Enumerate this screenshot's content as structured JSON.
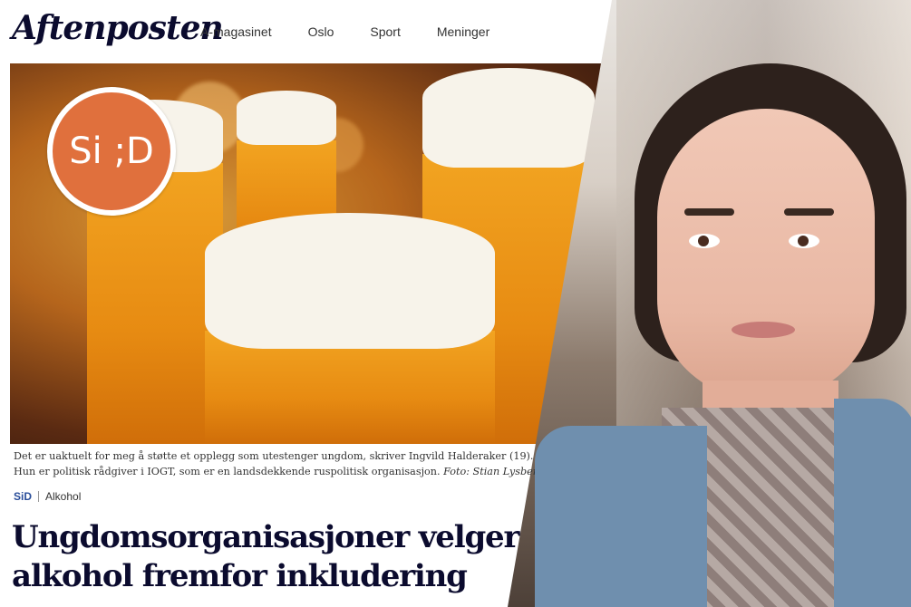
{
  "header": {
    "logo": "Aftenposten",
    "nav": [
      "A-magasinet",
      "Oslo",
      "Sport",
      "Meninger"
    ]
  },
  "hero": {
    "badge_text": "Si ;D",
    "badge_color": "#e0703d"
  },
  "caption": {
    "line1": "Det er uaktuelt for meg å støtte et opplegg som utestenger ungdom, skriver Ingvild Halderaker (19).",
    "line2": "Hun er politisk rådgiver i IOGT, som er en landsdekkende ruspolitisk organisasjon.",
    "credit": "Foto: Stian Lysberg Solum"
  },
  "tags": {
    "section": "SiD",
    "topic": "Alkohol"
  },
  "headline": {
    "line1": "Ungdomsorganisasjoner velger",
    "line2": "alkohol fremfor inkludering"
  },
  "colors": {
    "brand_navy": "#0b0b2e",
    "section_blue": "#2a4e9a"
  }
}
